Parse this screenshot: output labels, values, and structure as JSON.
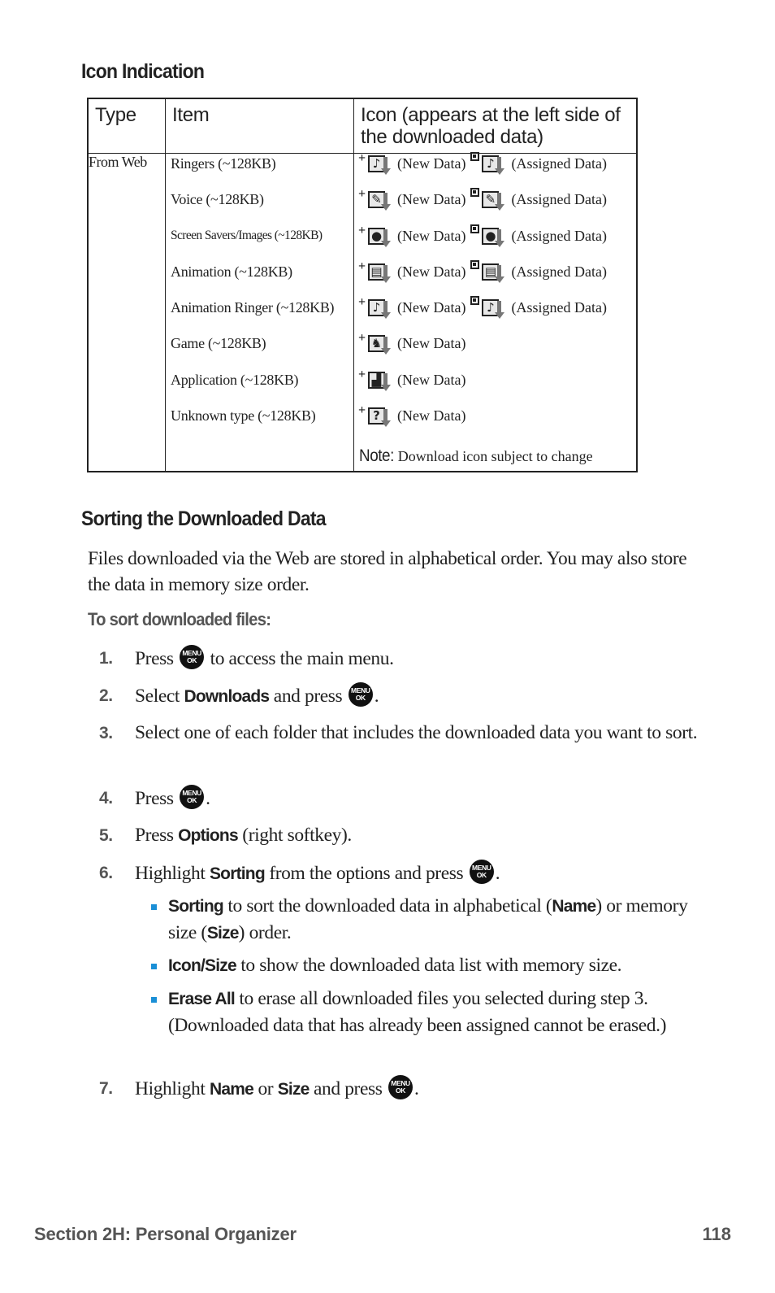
{
  "icon_indication": {
    "heading": "Icon Indication",
    "columns": [
      "Type",
      "Item",
      "Icon (appears at the left side of the downloaded data)"
    ],
    "type_value": "From Web",
    "rows": [
      {
        "item": "Ringers (~128KB)",
        "icon": "ringer-icon",
        "glyph": "♪",
        "new_label": "(New Data)",
        "assigned_label": "(Assigned Data)"
      },
      {
        "item": "Voice (~128KB)",
        "icon": "voice-icon",
        "glyph": "✎",
        "new_label": "(New Data)",
        "assigned_label": "(Assigned Data)"
      },
      {
        "item": "Screen Savers/Images (~128KB)",
        "icon": "image-icon",
        "glyph": "●",
        "new_label": "(New Data)",
        "assigned_label": "(Assigned Data)"
      },
      {
        "item": "Animation (~128KB)",
        "icon": "animation-icon",
        "glyph": "▤",
        "new_label": "(New Data)",
        "assigned_label": "(Assigned Data)"
      },
      {
        "item": "Animation Ringer (~128KB)",
        "icon": "animation-ringer-icon",
        "glyph": "♪",
        "new_label": "(New Data)",
        "assigned_label": "(Assigned Data)"
      },
      {
        "item": "Game (~128KB)",
        "icon": "game-icon",
        "glyph": "♞",
        "new_label": "(New Data)"
      },
      {
        "item": "Application (~128KB)",
        "icon": "application-icon",
        "glyph": "▟",
        "new_label": "(New Data)"
      },
      {
        "item": "Unknown type (~128KB)",
        "icon": "unknown-icon",
        "glyph": "?",
        "new_label": "(New Data)"
      }
    ],
    "note_label": "Note:",
    "note_text": "Download icon subject to change"
  },
  "sorting": {
    "heading": "Sorting the Downloaded Data",
    "intro": "Files downloaded via the Web are stored in alphabetical order. You may also store the data in memory size order.",
    "subheading": "To sort downloaded files:",
    "menu_key": {
      "line1": "MENU",
      "line2": "OK"
    },
    "steps": [
      {
        "num": "1.",
        "a": "Press ",
        "b": " to access the main menu."
      },
      {
        "num": "2.",
        "a": "Select ",
        "bold": "Downloads",
        "b": " and press ",
        "c": "."
      },
      {
        "num": "3.",
        "a": "Select one of each folder that includes the downloaded data you want to sort."
      },
      {
        "num": "4.",
        "a": "Press ",
        "b": "."
      },
      {
        "num": "5.",
        "a": "Press ",
        "bold": "Options",
        "b": " (right softkey)."
      },
      {
        "num": "6.",
        "a": "Highlight ",
        "bold": "Sorting",
        "b": " from the options and press ",
        "c": "."
      },
      {
        "num": "7.",
        "a": "Highlight ",
        "bold": "Name",
        "b": " or ",
        "bold2": "Size",
        "c": " and press ",
        "d": "."
      }
    ],
    "bullets": [
      {
        "bold": "Sorting",
        "a": " to sort the downloaded data in alphabetical (",
        "bold2": "Name",
        "b": ") or memory size (",
        "bold3": "Size",
        "c": ") order."
      },
      {
        "bold": "Icon/Size",
        "a": " to show the downloaded data list with memory size."
      },
      {
        "bold": "Erase All",
        "a": " to erase all downloaded files you selected during step 3. (Downloaded data that has already been assigned cannot be erased.)"
      }
    ]
  },
  "footer": {
    "section": "Section 2H: Personal Organizer",
    "page": "118"
  },
  "colors": {
    "bullet": "#1a8fd6",
    "text": "#222222",
    "subtle_heading": "#555555"
  }
}
